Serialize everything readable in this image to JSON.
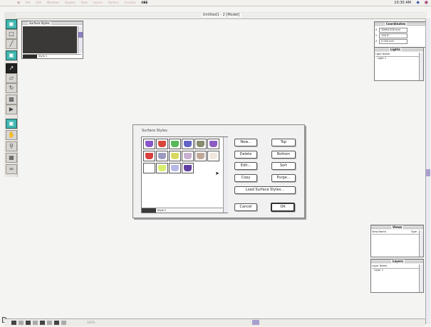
{
  "menubar": {
    "menus": [
      "File",
      "Edit",
      "Windows",
      "Display",
      "View",
      "Layers",
      "Options",
      "Cavalier",
      "OBE"
    ],
    "clock": "10:30 AM"
  },
  "document": {
    "title": "Untitled1 - 2 [Model]"
  },
  "surface_styles_window": {
    "title": "Surface Styles",
    "style_label": "Style 1"
  },
  "coordinates_palette": {
    "title": "Coordinates",
    "rows": [
      {
        "axis": "X",
        "value": "10694.000 mm"
      },
      {
        "axis": "Y",
        "value": "128.5°"
      },
      {
        "axis": "Z",
        "value": "0.000 mm"
      }
    ]
  },
  "lights_palette": {
    "title": "Lights",
    "header": "Light Name",
    "items": [
      "Light 1"
    ]
  },
  "views_palette": {
    "title": "Views",
    "header": "View Name",
    "header_col2": "Type"
  },
  "layers_palette": {
    "title": "Layers",
    "header": "Layer Name",
    "items": [
      "Layer 1"
    ]
  },
  "dialog": {
    "title": "Surface Styles",
    "style_label": "Style 1",
    "buttons": {
      "new": "New...",
      "delete": "Delete",
      "edit": "Edit...",
      "copy": "Copy",
      "top": "Top",
      "bottom": "Bottom",
      "sort": "Sort",
      "purge": "Purge...",
      "load": "Load Surface Styles...",
      "cancel": "Cancel",
      "ok": "OK"
    },
    "swatch_colors": [
      [
        "#8a55c8",
        "#d8463a",
        "#58b85a",
        "#6464c8",
        "#8a8a70",
        "#8c5ac0"
      ],
      [
        "#d84040",
        "#9a9ac0",
        "#d8d860",
        "#c8b0d0",
        "#c0a898",
        "#f0e8dc"
      ],
      [
        "#ffffff",
        "#d8f070",
        "#b8b8e8",
        "#6040a0"
      ]
    ]
  },
  "statusbar": {
    "page_indicator": "100%"
  }
}
